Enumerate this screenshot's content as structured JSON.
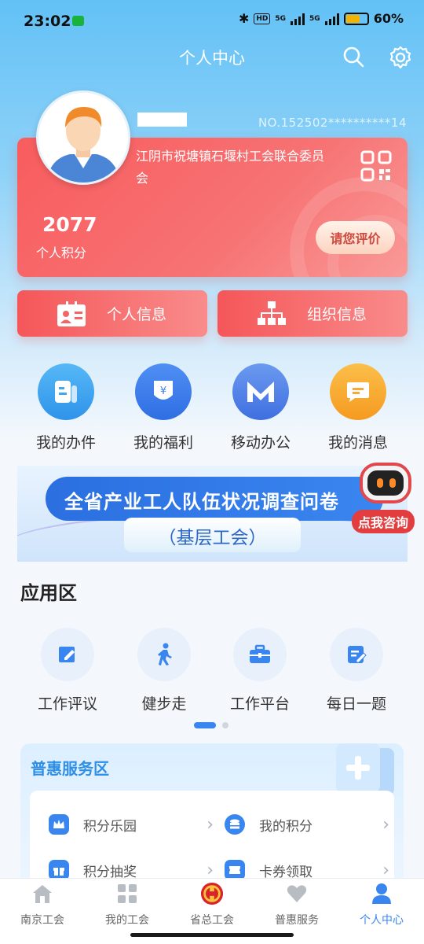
{
  "status_bar": {
    "time": "23:02",
    "battery": "60%",
    "network_a": "5G",
    "network_b": "5G"
  },
  "header": {
    "title": "个人中心"
  },
  "profile": {
    "member_no": "NO.152502**********14",
    "organization": "江阴市祝塘镇石堰村工会联合委员会",
    "points_value": "2077",
    "points_label": "个人积分",
    "rate_button": "请您评价"
  },
  "info_buttons": {
    "personal": "个人信息",
    "org": "组织信息"
  },
  "quick_actions": [
    {
      "label": "我的办件",
      "color": "#3fa8f2"
    },
    {
      "label": "我的福利",
      "color": "#3f7fee"
    },
    {
      "label": "移动办公",
      "color": "#5a86ea"
    },
    {
      "label": "我的消息",
      "color": "#f7a933"
    }
  ],
  "banner": {
    "title": "全省产业工人队伍状况调查问卷",
    "subtitle": "（基层工会）",
    "bot_label": "点我咨询"
  },
  "apps_section": {
    "title": "应用区",
    "items": [
      {
        "label": "工作评议"
      },
      {
        "label": "健步走"
      },
      {
        "label": "工作平台"
      },
      {
        "label": "每日一题"
      }
    ]
  },
  "benefits": {
    "title": "普惠服务区",
    "items": [
      {
        "label": "积分乐园"
      },
      {
        "label": "我的积分"
      },
      {
        "label": "积分抽奖"
      },
      {
        "label": "卡券领取"
      }
    ]
  },
  "tabbar": {
    "items": [
      {
        "label": "南京工会"
      },
      {
        "label": "我的工会"
      },
      {
        "label": "省总工会"
      },
      {
        "label": "普惠服务"
      },
      {
        "label": "个人中心"
      }
    ]
  },
  "colors": {
    "accent": "#3a86f0",
    "card_red": "#f85c5e"
  }
}
